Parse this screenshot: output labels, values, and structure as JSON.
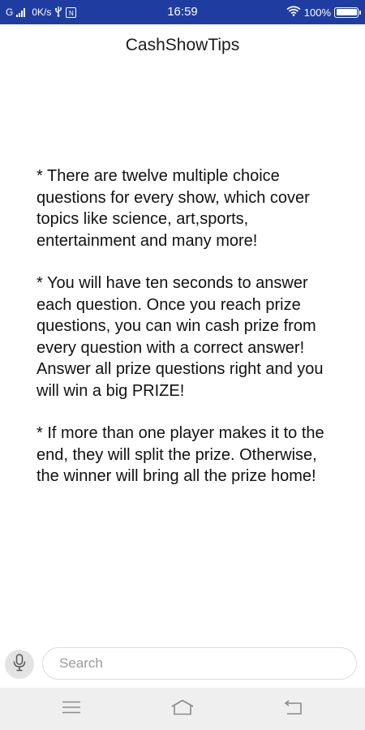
{
  "status_bar": {
    "carrier": "G",
    "speed": "0K/s",
    "usb_icon": "usb-icon",
    "badge": "N",
    "time": "16:59",
    "wifi_icon": "wifi-icon",
    "battery_percent": "100%",
    "battery_level": 1.0,
    "background": "#1f3da1"
  },
  "app": {
    "title": "CashShowTips"
  },
  "content": {
    "paragraphs": [
      "* There are twelve multiple choice questions for every show, which cover topics like science, art,sports, entertainment and many more!",
      "* You will have ten seconds to answer each question. Once you reach prize questions, you can win cash prize from every question with a correct answer! Answer all prize questions right and you will win a big PRIZE!",
      "* If more than one player makes it to the end, they will split the prize. Otherwise, the winner will bring all the prize home!"
    ]
  },
  "search": {
    "mic_icon": "microphone-icon",
    "placeholder": "Search",
    "value": ""
  },
  "nav": {
    "menu_icon": "menu-icon",
    "home_icon": "home-icon",
    "back_icon": "back-icon"
  }
}
